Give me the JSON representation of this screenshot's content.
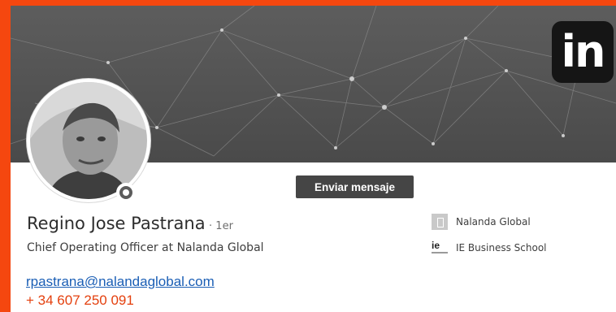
{
  "profile": {
    "name": "Regino Jose Pastrana",
    "degree": "· 1er",
    "headline": "Chief Operating Officer at Nalanda Global",
    "email": "rpastrana@nalandaglobal.com",
    "phone": "+ 34 607 250 091",
    "message_button": "Enviar mensaje"
  },
  "brand": {
    "logo_text": "in",
    "icon": "linkedin-icon"
  },
  "organizations": [
    {
      "name": "Nalanda Global",
      "icon": "building-icon"
    },
    {
      "name": "IE Business School",
      "icon": "ie-logo",
      "logo_text": "ie"
    }
  ],
  "colors": {
    "border": "#f5470f",
    "email": "#1a5eb5",
    "phone": "#e4400e",
    "button": "#454545"
  }
}
